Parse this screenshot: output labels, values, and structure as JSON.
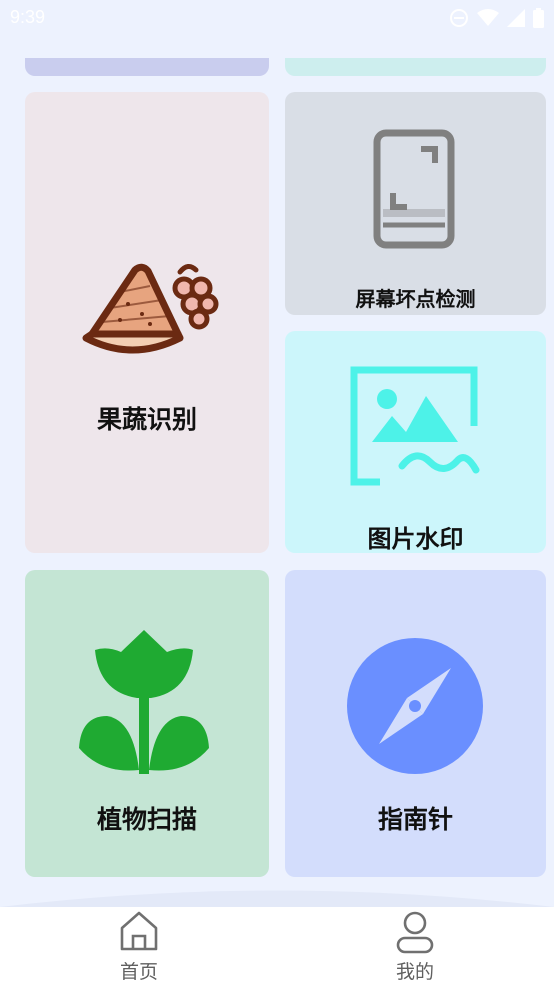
{
  "status_bar": {
    "time": "9:39",
    "icons": [
      "do-not-disturb-icon",
      "wifi-icon",
      "cellular-signal-icon",
      "battery-icon"
    ]
  },
  "cards": {
    "fruit_veg": {
      "label": "果蔬识别",
      "icon": "fruit-veg-icon",
      "bg": "#EEE6EB"
    },
    "dead_pixel": {
      "label": "屏幕坏点检测",
      "icon": "phone-screen-icon",
      "bg": "#D9DEE6"
    },
    "watermark": {
      "label": "图片水印",
      "icon": "image-watermark-icon",
      "bg": "#CCF6FB"
    },
    "plant": {
      "label": "植物扫描",
      "icon": "plant-icon",
      "bg": "#C4E5D4"
    },
    "compass": {
      "label": "指南针",
      "icon": "compass-icon",
      "bg": "#D3DDFC"
    }
  },
  "bottom_nav": {
    "items": [
      {
        "label": "首页",
        "icon": "home-icon"
      },
      {
        "label": "我的",
        "icon": "profile-icon"
      }
    ]
  },
  "colors": {
    "page_bg": "#EDF2FE",
    "fruit_outline": "#6B2A12",
    "watermark_accent": "#4DF2E8",
    "plant_green": "#1FAA32",
    "compass_blue": "#6A8FFF"
  }
}
